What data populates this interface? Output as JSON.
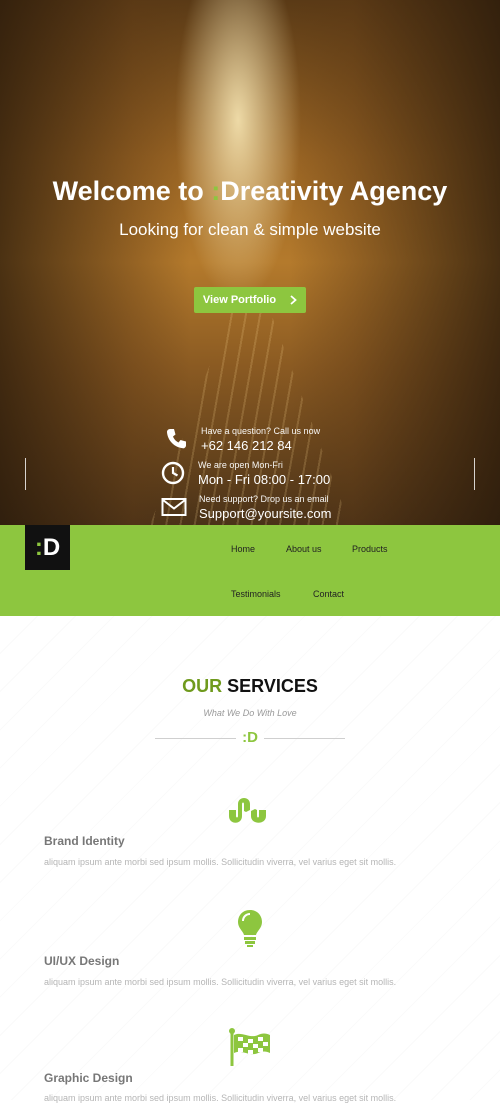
{
  "hero": {
    "title_prefix": "Welcome to ",
    "logo_glyph": ":",
    "title_suffix": "Dreativity Agency",
    "subtitle": "Looking for clean & simple website",
    "cta_label": "View Portfolio",
    "cta_icon": "chevron-right-icon"
  },
  "contacts": [
    {
      "icon": "phone-icon",
      "small": "Have a question? Call us now",
      "big": "+62 146 212 84"
    },
    {
      "icon": "clock-icon",
      "small": "We are open Mon-Fri",
      "big": "Mon - Fri 08:00 - 17:00"
    },
    {
      "icon": "envelope-icon",
      "small": "Need support? Drop us an email",
      "big": "Support@yoursite.com"
    }
  ],
  "nav": {
    "logo_colon": ":",
    "logo_letter": "D",
    "items": [
      "Home",
      "About us",
      "Products",
      "Testimonials",
      "Contact"
    ]
  },
  "services": {
    "title_accent": "OUR",
    "title_rest": " SERVICES",
    "subtitle": "What We Do With Love",
    "divider_logo_colon": ":",
    "divider_logo_letter": "D",
    "items": [
      {
        "icon": "stumbleupon-icon",
        "title": "Brand Identity",
        "desc": "aliquam ipsum ante morbi sed ipsum mollis. Sollicitudin viverra, vel varius eget sit mollis."
      },
      {
        "icon": "lightbulb-icon",
        "title": "UI/UX Design",
        "desc": "aliquam ipsum ante morbi sed ipsum mollis. Sollicitudin viverra, vel varius eget sit mollis."
      },
      {
        "icon": "flag-icon",
        "title": "Graphic Design",
        "desc": "aliquam ipsum ante morbi sed ipsum mollis. Sollicitudin viverra, vel varius eget sit mollis."
      }
    ]
  },
  "colors": {
    "accent": "#8dc63f",
    "dark": "#111111"
  }
}
